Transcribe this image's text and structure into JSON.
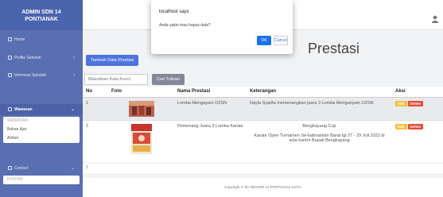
{
  "sidebar": {
    "brand": "ADMIN SDN 14\nPONTIANAK",
    "items": [
      {
        "label": "Home"
      },
      {
        "label": "Profile Sekolah"
      },
      {
        "label": "Informasi Sekolah"
      },
      {
        "label": "Wawasan"
      },
      {
        "label": "Contact"
      }
    ],
    "wawasan_sub": [
      {
        "label": "WAWASAN"
      },
      {
        "label": "Bahan Ajar"
      },
      {
        "label": "Artikel"
      }
    ],
    "contact_sub": [
      {
        "label": "KONTAK"
      }
    ]
  },
  "page": {
    "title": "Prestasi",
    "add_button": "Tambah Data Prestasi",
    "search_placeholder": "Masukkan Kata Kunci",
    "search_button": "Cari Tulisan"
  },
  "table": {
    "headers": [
      "No",
      "Foto",
      "Nama Prestasi",
      "Keterangan",
      "Aksi"
    ],
    "rows": [
      {
        "no": "1",
        "nama": "Lomba Mengayam O2SN",
        "keterangan": "Nayla Syarifa memenangkan juara 3 Lomba Menganyam O2SN",
        "edit": "Edit",
        "delete": "Delete"
      },
      {
        "no": "2",
        "nama": "Pemenang Juara 3 Lomba Karate",
        "keterangan_line1": "Bengkayang Cup",
        "keterangan_line2": "Karate Open Turnamen Se-kalimantan Barat tgl 27 - 29 Juli 2022 di aula kantor Bupati Bengkayang",
        "edit": "Edit",
        "delete": "Delete"
      }
    ]
  },
  "pagination": {
    "current": "1"
  },
  "footer": "Copyright © SD NEGERI 14 PONTIANAK KOTA",
  "dialog": {
    "title": "localhost says",
    "message": "Anda yakin mau hapus data?",
    "ok": "OK",
    "cancel": "Cancel"
  },
  "colors": {
    "sidebar": "#5a6fb1",
    "primary": "#4e73df",
    "edit": "#f6c23e",
    "delete": "#e74a3b"
  }
}
